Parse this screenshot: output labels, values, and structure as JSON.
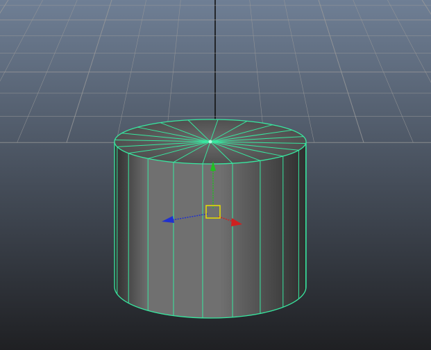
{
  "viewport": {
    "background_top": "#6f7f95",
    "background_bottom": "#1f2023",
    "grid_color": "#9a9a9a",
    "grid_axis_color": "#111111"
  },
  "object": {
    "type": "cylinder",
    "wireframe_color": "#38e8a0",
    "side_segments": 20,
    "body_color_light": "#707070",
    "body_color_dark": "#2e2e2e"
  },
  "manipulator": {
    "x_axis_color": "#d02020",
    "y_axis_color": "#20c020",
    "z_axis_color": "#2030d0",
    "center_color": "#e8e000",
    "icon": "move-tool-icon"
  }
}
